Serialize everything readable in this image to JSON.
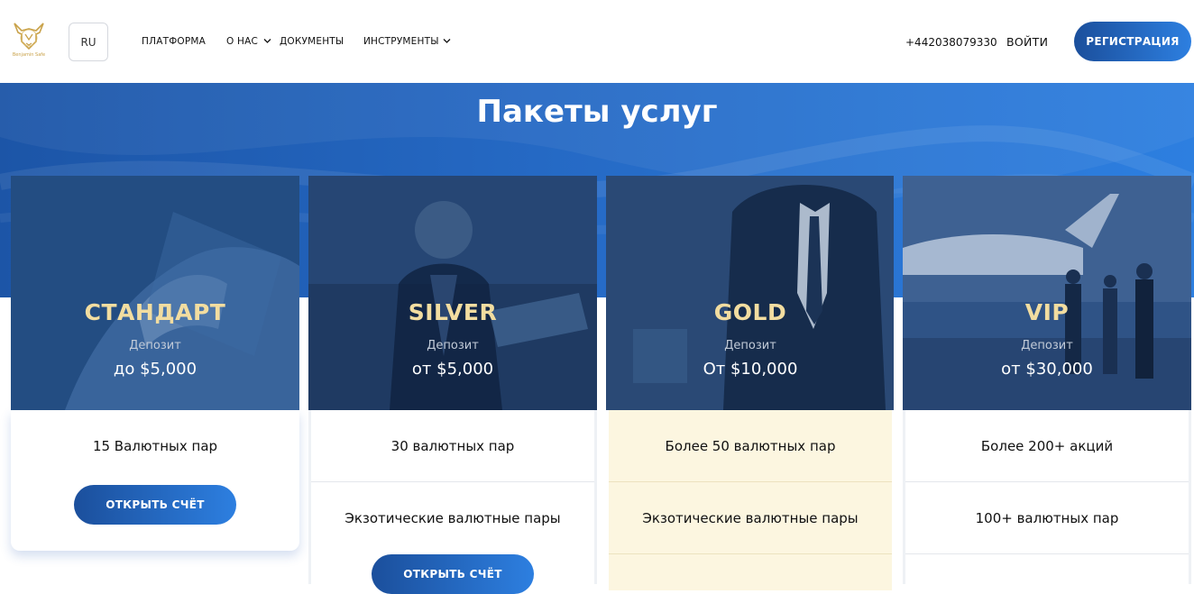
{
  "header": {
    "logo_text": "Benjamin Safe",
    "language": "RU",
    "nav": {
      "platform": "ПЛАТФОРМА",
      "about": "О НАС",
      "documents": "ДОКУМЕНТЫ",
      "tools": "ИНСТРУМЕНТЫ"
    },
    "phone": "+442038079330",
    "login": "ВОЙТИ",
    "register": "РЕГИСТРАЦИЯ"
  },
  "banner": {
    "title": "Пакеты услуг"
  },
  "cards": [
    {
      "name": "СТАНДАРТ",
      "deposit_label": "Депозит",
      "deposit_value": "до $5,000",
      "features": [
        "15 Валютных пар"
      ],
      "button": "ОТКРЫТЬ СЧЁТ"
    },
    {
      "name": "SILVER",
      "deposit_label": "Депозит",
      "deposit_value": "от $5,000",
      "features": [
        "30 валютных пар",
        "Экзотические валютные пары"
      ],
      "button": "ОТКРЫТЬ СЧЁТ"
    },
    {
      "name": "GOLD",
      "deposit_label": "Депозит",
      "deposit_value": "От $10,000",
      "features": [
        "Более 50 валютных пар",
        "Экзотические валютные пары"
      ]
    },
    {
      "name": "VIP",
      "deposit_label": "Депозит",
      "deposit_value": "от $30,000",
      "features": [
        "Более 200+ акций",
        "100+ валютных пар"
      ]
    }
  ],
  "colors": {
    "brand_blue": "#1b4f9c",
    "accent_blue": "#2d7fe0",
    "package_title_gold": "#f2dda0",
    "gold_card_bg": "#fcf6e0",
    "logo_gold": "#c9a24a"
  }
}
